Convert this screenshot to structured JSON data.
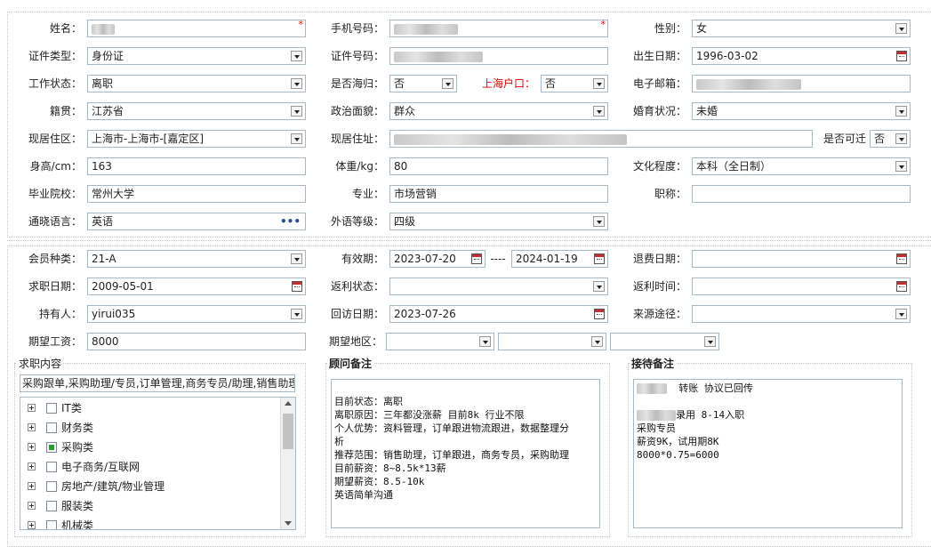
{
  "personal": {
    "name": {
      "label": "姓名："
    },
    "phone": {
      "label": "手机号码："
    },
    "gender": {
      "label": "性别：",
      "value": "女"
    },
    "id_type": {
      "label": "证件类型：",
      "value": "身份证"
    },
    "id_number": {
      "label": "证件号码："
    },
    "birth_date": {
      "label": "出生日期：",
      "value": "1996-03-02"
    },
    "work_status": {
      "label": "工作状态：",
      "value": "离职"
    },
    "overseas": {
      "label": "是否海归：",
      "value": "否"
    },
    "shanghai_hukou": {
      "label": "上海户口：",
      "value": "否"
    },
    "email": {
      "label": "电子邮箱："
    },
    "native_place": {
      "label": "籍贯：",
      "value": "江苏省"
    },
    "political": {
      "label": "政治面貌：",
      "value": "群众"
    },
    "marital": {
      "label": "婚育状况：",
      "value": "未婚"
    },
    "residence_area": {
      "label": "现居住区：",
      "value": "上海市-上海市-[嘉定区]"
    },
    "residence_address": {
      "label": "现居住址："
    },
    "relocate": {
      "label": "是否可迁",
      "value": "否"
    },
    "height": {
      "label": "身高/cm：",
      "value": "163"
    },
    "weight": {
      "label": "体重/kg：",
      "value": "80"
    },
    "education": {
      "label": "文化程度：",
      "value": "本科（全日制）"
    },
    "school": {
      "label": "毕业院校：",
      "value": "常州大学"
    },
    "major": {
      "label": "专业：",
      "value": "市场营销"
    },
    "title": {
      "label": "职称：",
      "value": ""
    },
    "language": {
      "label": "通晓语言：",
      "value": "英语"
    },
    "language_level": {
      "label": "外语等级：",
      "value": "四级"
    }
  },
  "membership": {
    "member_type": {
      "label": "会员种类：",
      "value": "21-A"
    },
    "validity": {
      "label": "有效期：",
      "start": "2023-07-20",
      "separator": "----",
      "end": "2024-01-19"
    },
    "refund_date": {
      "label": "退费日期：",
      "value": ""
    },
    "job_date": {
      "label": "求职日期：",
      "value": "2009-05-01"
    },
    "rebate_status": {
      "label": "返利状态：",
      "value": ""
    },
    "rebate_time": {
      "label": "返利时间：",
      "value": ""
    },
    "holder": {
      "label": "持有人：",
      "value": "yirui035"
    },
    "visit_date": {
      "label": "回访日期：",
      "value": "2023-07-26"
    },
    "source": {
      "label": "来源途径：",
      "value": ""
    },
    "expected_salary": {
      "label": "期望工资：",
      "value": "8000"
    },
    "expected_area": {
      "label": "期望地区：",
      "values": [
        "",
        "",
        ""
      ]
    }
  },
  "job_content": {
    "title": "求职内容",
    "summary": "采购跟单,采购助理/专员,订单管理,商务专员/助理,销售助理",
    "tree": [
      {
        "label": "IT类",
        "checked": false
      },
      {
        "label": "财务类",
        "checked": false
      },
      {
        "label": "采购类",
        "checked": true
      },
      {
        "label": "电子商务/互联网",
        "checked": false
      },
      {
        "label": "房地产/建筑/物业管理",
        "checked": false
      },
      {
        "label": "服装类",
        "checked": false
      },
      {
        "label": "机械类",
        "checked": false
      }
    ]
  },
  "consultant_notes": {
    "title": "顾问备注",
    "lines": [
      "目前状态：离职",
      "离职原因：三年都没涨薪 目前8k  行业不限",
      "个人优势：资料管理，订单跟进物流跟进，数据整理分",
      "析",
      "推荐范围：销售助理，订单跟进，商务专员，采购助理",
      "目前薪资：8~8.5k*13薪",
      "期望薪资：8.5-10k",
      "英语简单沟通"
    ]
  },
  "reception_notes": {
    "title": "接待备注",
    "line1": "转账  协议已回传",
    "line2": "录用  8-14入职",
    "line3": "采购专员",
    "line4": "薪资9K，试用期8K",
    "line5": "8000*0.75=6000"
  },
  "colors": {
    "required": "#e00000",
    "hukou_label": "#e00000",
    "checked_box": "#2e9a2e",
    "input_border": "#a7b8c9"
  }
}
